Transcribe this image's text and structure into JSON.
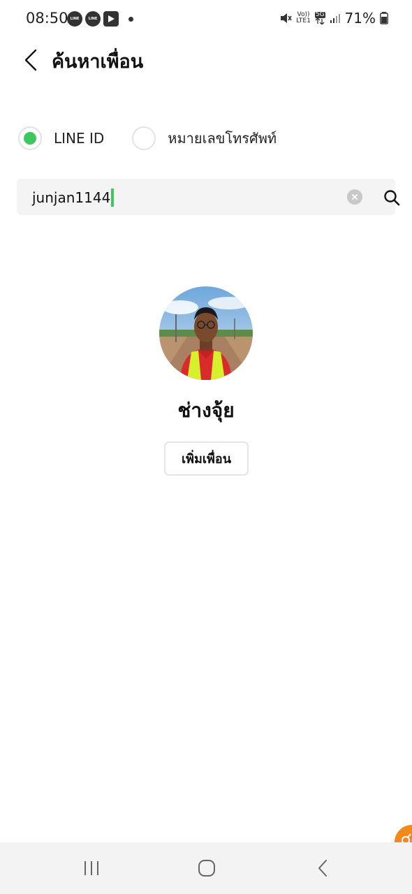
{
  "status_bar": {
    "time": "08:50",
    "notifications": [
      "line-icon",
      "line-icon",
      "play-icon",
      "more-dot-icon"
    ],
    "line_badge": "LINE",
    "volte_label": "Vo))",
    "lte_label": "LTE1",
    "network_label": "5G",
    "battery_percent": "71%"
  },
  "header": {
    "title": "ค้นหาเพื่อน"
  },
  "search_type": {
    "options": [
      {
        "label": "LINE ID",
        "selected": true
      },
      {
        "label": "หมายเลขโทรศัพท์",
        "selected": false
      }
    ]
  },
  "search": {
    "value": "junjan1144"
  },
  "profile": {
    "name": "ช่างจุ้ย",
    "add_button_label": "เพิ่มเพื่อน"
  },
  "nav": {
    "buttons": [
      "recent-apps-icon",
      "home-icon",
      "back-icon"
    ]
  },
  "colors": {
    "accent": "#3dc85e",
    "badge": "#f08a1a"
  }
}
